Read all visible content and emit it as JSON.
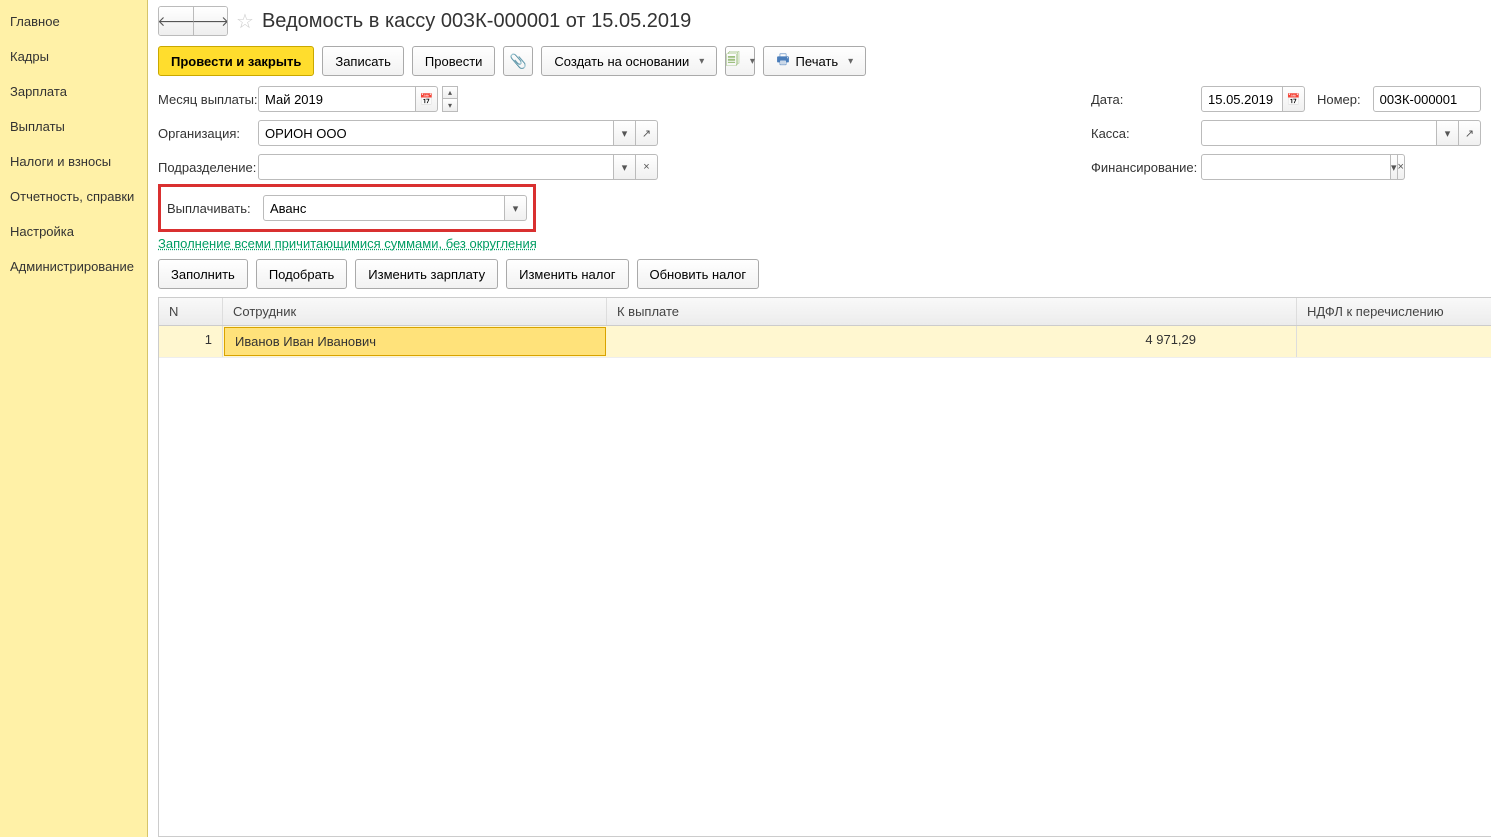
{
  "sidebar": {
    "items": [
      {
        "label": "Главное"
      },
      {
        "label": "Кадры"
      },
      {
        "label": "Зарплата"
      },
      {
        "label": "Выплаты"
      },
      {
        "label": "Налоги и взносы"
      },
      {
        "label": "Отчетность, справки"
      },
      {
        "label": "Настройка"
      },
      {
        "label": "Администрирование"
      }
    ]
  },
  "header": {
    "title": "Ведомость в кассу 00ЗК-000001 от 15.05.2019"
  },
  "toolbar": {
    "post_close": "Провести и закрыть",
    "write": "Записать",
    "post": "Провести",
    "create_based": "Создать на основании",
    "print": "Печать"
  },
  "form": {
    "month_label": "Месяц выплаты:",
    "month_value": "Май 2019",
    "org_label": "Организация:",
    "org_value": "ОРИОН ООО",
    "dept_label": "Подразделение:",
    "dept_value": "",
    "pay_label": "Выплачивать:",
    "pay_value": "Аванс",
    "date_label": "Дата:",
    "date_value": "15.05.2019",
    "number_label": "Номер:",
    "number_value": "00ЗК-000001",
    "kassa_label": "Касса:",
    "kassa_value": "",
    "fin_label": "Финансирование:",
    "fin_value": ""
  },
  "link": {
    "fill_all": "Заполнение всеми причитающимися суммами, без округления"
  },
  "toolbar2": {
    "fill": "Заполнить",
    "pick": "Подобрать",
    "change_salary": "Изменить зарплату",
    "change_tax": "Изменить налог",
    "update_tax": "Обновить налог"
  },
  "table": {
    "headers": {
      "n": "N",
      "employee": "Сотрудник",
      "to_pay": "К выплате",
      "ndfl": "НДФЛ к перечислению"
    },
    "rows": [
      {
        "n": "1",
        "employee": "Иванов Иван Иванович",
        "to_pay": "4 971,29",
        "ndfl": ""
      }
    ]
  }
}
